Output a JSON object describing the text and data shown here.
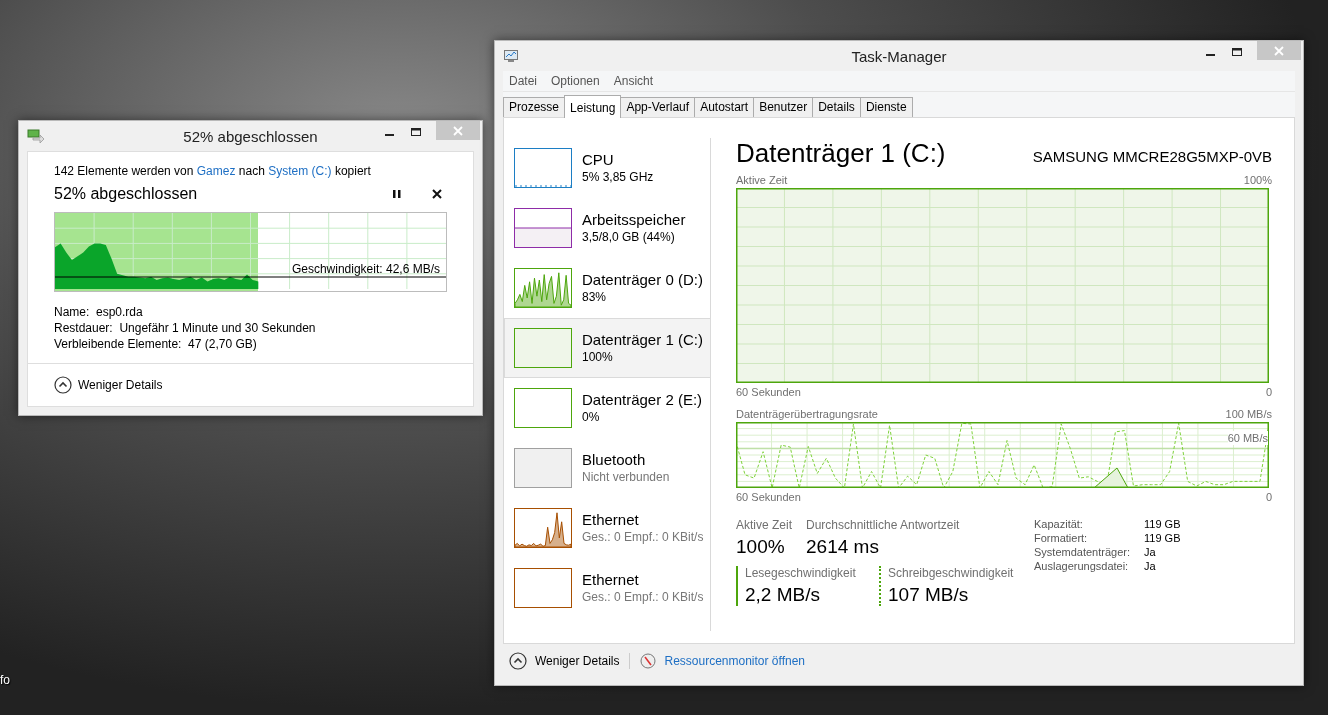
{
  "desktop": {
    "icon_label": "fo"
  },
  "copy_dialog": {
    "title": "52% abgeschlossen",
    "summary": {
      "prefix": "142 Elemente werden von",
      "source": "Gamez",
      "middle": "nach",
      "destination": "System (C:)",
      "suffix": "kopiert"
    },
    "progress_heading": "52% abgeschlossen",
    "level": 0.52,
    "speed": "Geschwindigkeit: 42,6 MB/s",
    "details": [
      {
        "label": "Name:",
        "value": "esp0.rda"
      },
      {
        "label": "Restdauer:",
        "value": "Ungefähr 1 Minute und 30 Sekunden"
      },
      {
        "label": "Verbleibende Elemente:",
        "value": "47 (2,70 GB)"
      }
    ],
    "toggle": "Weniger Details"
  },
  "task_manager": {
    "title": "Task-Manager",
    "menu": [
      "Datei",
      "Optionen",
      "Ansicht"
    ],
    "tabs": [
      {
        "label": "Prozesse",
        "selected": false
      },
      {
        "label": "Leistung",
        "selected": true
      },
      {
        "label": "App-Verlauf",
        "selected": false
      },
      {
        "label": "Autostart",
        "selected": false
      },
      {
        "label": "Benutzer",
        "selected": false
      },
      {
        "label": "Details",
        "selected": false
      },
      {
        "label": "Dienste",
        "selected": false
      }
    ],
    "sidebar": [
      {
        "kind": "cpu",
        "name": "CPU",
        "detail": "5%  3,85 GHz",
        "color": "#1c7ec4",
        "selected": false
      },
      {
        "kind": "memory",
        "name": "Arbeitsspeicher",
        "detail": "3,5/8,0 GB (44%)",
        "color": "#8e2ca8",
        "selected": false
      },
      {
        "kind": "disk",
        "name": "Datenträger 0 (D:)",
        "detail": "83%",
        "color": "#4da60c",
        "selected": false
      },
      {
        "kind": "disk",
        "name": "Datenträger 1 (C:)",
        "detail": "100%",
        "color": "#4da60c",
        "selected": true
      },
      {
        "kind": "disk",
        "name": "Datenträger 2 (E:)",
        "detail": "0%",
        "color": "#4da60c",
        "selected": false
      },
      {
        "kind": "bluetooth",
        "name": "Bluetooth",
        "detail": "Nicht verbunden",
        "color": "#a0a0a0",
        "selected": false
      },
      {
        "kind": "ethernet",
        "name": "Ethernet",
        "detail": "Ges.: 0 Empf.: 0 KBit/s",
        "color": "#a74f01",
        "selected": false
      },
      {
        "kind": "ethernet",
        "name": "Ethernet",
        "detail": "Ges.: 0 Empf.: 0 KBit/s",
        "color": "#a74f01",
        "selected": false
      }
    ],
    "panel": {
      "title": "Datenträger 1 (C:)",
      "model": "SAMSUNG MMCRE28G5MXP-0VB",
      "active_chart": {
        "label": "Aktive Zeit",
        "max": "100%",
        "span": "60 Sekunden",
        "min": "0"
      },
      "transfer_chart": {
        "label": "Datenträgerübertragungsrate",
        "max": "100 MB/s",
        "mid": "60 MB/s",
        "span": "60 Sekunden",
        "min": "0"
      },
      "stats": [
        {
          "label": "Aktive Zeit",
          "value": "100%"
        },
        {
          "label": "Durchschnittliche Antwortzeit",
          "value": "2614 ms"
        }
      ],
      "speeds": [
        {
          "kind": "read",
          "label": "Lesegeschwindigkeit",
          "value": "2,2 MB/s"
        },
        {
          "kind": "write",
          "label": "Schreibgeschwindigkeit",
          "value": "107 MB/s"
        }
      ],
      "properties": [
        {
          "label": "Kapazität:",
          "value": "119 GB"
        },
        {
          "label": "Formatiert:",
          "value": "119 GB"
        },
        {
          "label": "Systemdatenträger:",
          "value": "Ja"
        },
        {
          "label": "Auslagerungsdatei:",
          "value": "Ja"
        }
      ]
    },
    "footer": {
      "toggle": "Weniger Details",
      "link": "Ressourcenmonitor öffnen"
    }
  }
}
